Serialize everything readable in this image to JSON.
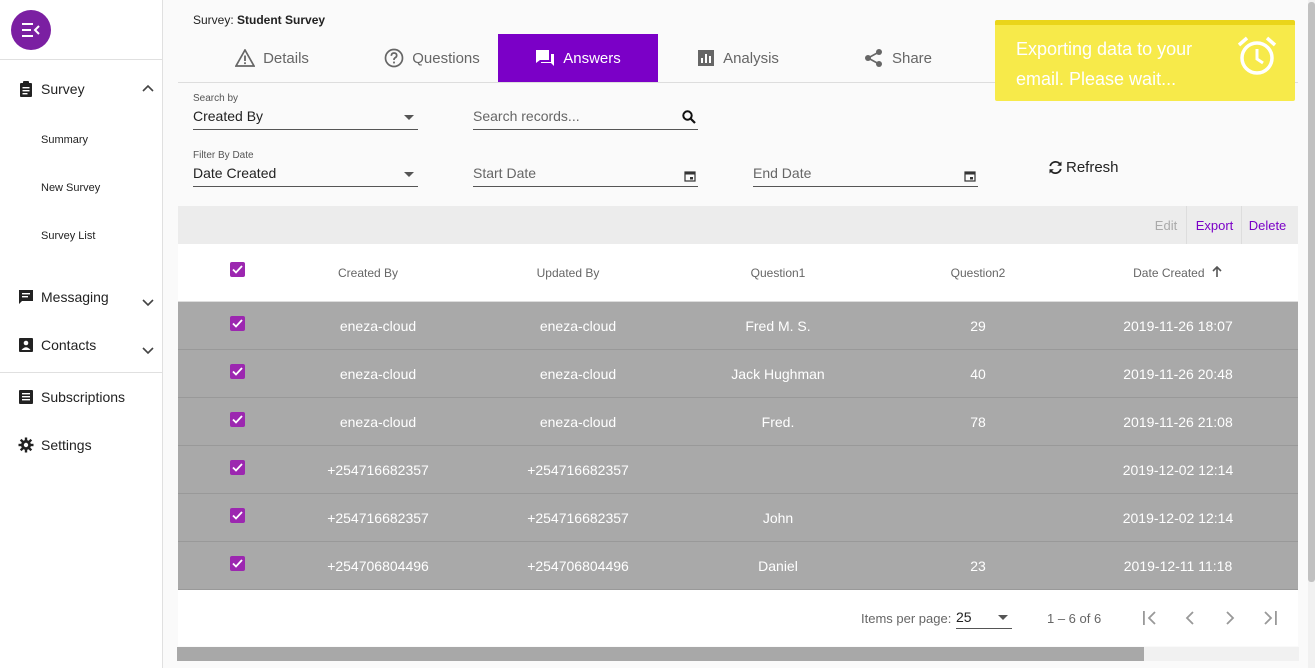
{
  "sidebar": {
    "menu_icon": "menu-open-icon",
    "items": [
      {
        "label": "Survey",
        "icon": "clipboard-icon",
        "expanded": true
      },
      {
        "label": "Messaging",
        "icon": "chat-icon",
        "expanded": false
      },
      {
        "label": "Contacts",
        "icon": "contacts-icon",
        "expanded": false
      },
      {
        "label": "Subscriptions",
        "icon": "list-icon"
      },
      {
        "label": "Settings",
        "icon": "gear-icon"
      }
    ],
    "survey_sub": [
      "Summary",
      "New Survey",
      "Survey List"
    ]
  },
  "header": {
    "prefix": "Survey: ",
    "name": "Student Survey"
  },
  "tabs": [
    {
      "label": "Details",
      "icon": "warning-icon"
    },
    {
      "label": "Questions",
      "icon": "help-circle-icon"
    },
    {
      "label": "Answers",
      "icon": "forum-icon",
      "active": true
    },
    {
      "label": "Analysis",
      "icon": "bar-chart-icon"
    },
    {
      "label": "Share",
      "icon": "share-icon"
    }
  ],
  "filters": {
    "search_by_label": "Search by",
    "search_by_value": "Created By",
    "search_placeholder": "Search records...",
    "filter_date_label": "Filter By Date",
    "filter_date_value": "Date Created",
    "start_date_placeholder": "Start Date",
    "end_date_placeholder": "End Date",
    "refresh_label": "Refresh"
  },
  "toast": {
    "message": "Exporting data to your email. Please wait...",
    "icon": "alarm-icon",
    "color": "#f7ea4a"
  },
  "toolbar": {
    "edit": "Edit",
    "export": "Export",
    "delete": "Delete"
  },
  "table": {
    "columns": [
      "Created By",
      "Updated By",
      "Question1",
      "Question2",
      "Date Created"
    ],
    "sort_column": "Date Created",
    "sort_direction": "ascending",
    "rows": [
      {
        "created_by": "eneza-cloud",
        "updated_by": "eneza-cloud",
        "q1": "Fred M. S.",
        "q2": "29",
        "date": "2019-11-26 18:07"
      },
      {
        "created_by": "eneza-cloud",
        "updated_by": "eneza-cloud",
        "q1": "Jack Hughman",
        "q2": "40",
        "date": "2019-11-26 20:48"
      },
      {
        "created_by": "eneza-cloud",
        "updated_by": "eneza-cloud",
        "q1": "Fred.",
        "q2": "78",
        "date": "2019-11-26 21:08"
      },
      {
        "created_by": "+254716682357",
        "updated_by": "+254716682357",
        "q1": "",
        "q2": "",
        "date": "2019-12-02 12:14"
      },
      {
        "created_by": "+254716682357",
        "updated_by": "+254716682357",
        "q1": "John",
        "q2": "",
        "date": "2019-12-02 12:14"
      },
      {
        "created_by": "+254706804496",
        "updated_by": "+254706804496",
        "q1": "Daniel",
        "q2": "23",
        "date": "2019-12-11 11:18"
      }
    ]
  },
  "paginator": {
    "items_per_page_label": "Items per page:",
    "page_size": "25",
    "range": "1 – 6 of 6"
  },
  "colors": {
    "accent": "#7b00c7",
    "checkbox": "#9c27b0",
    "row_bg": "#a9a9a9"
  }
}
